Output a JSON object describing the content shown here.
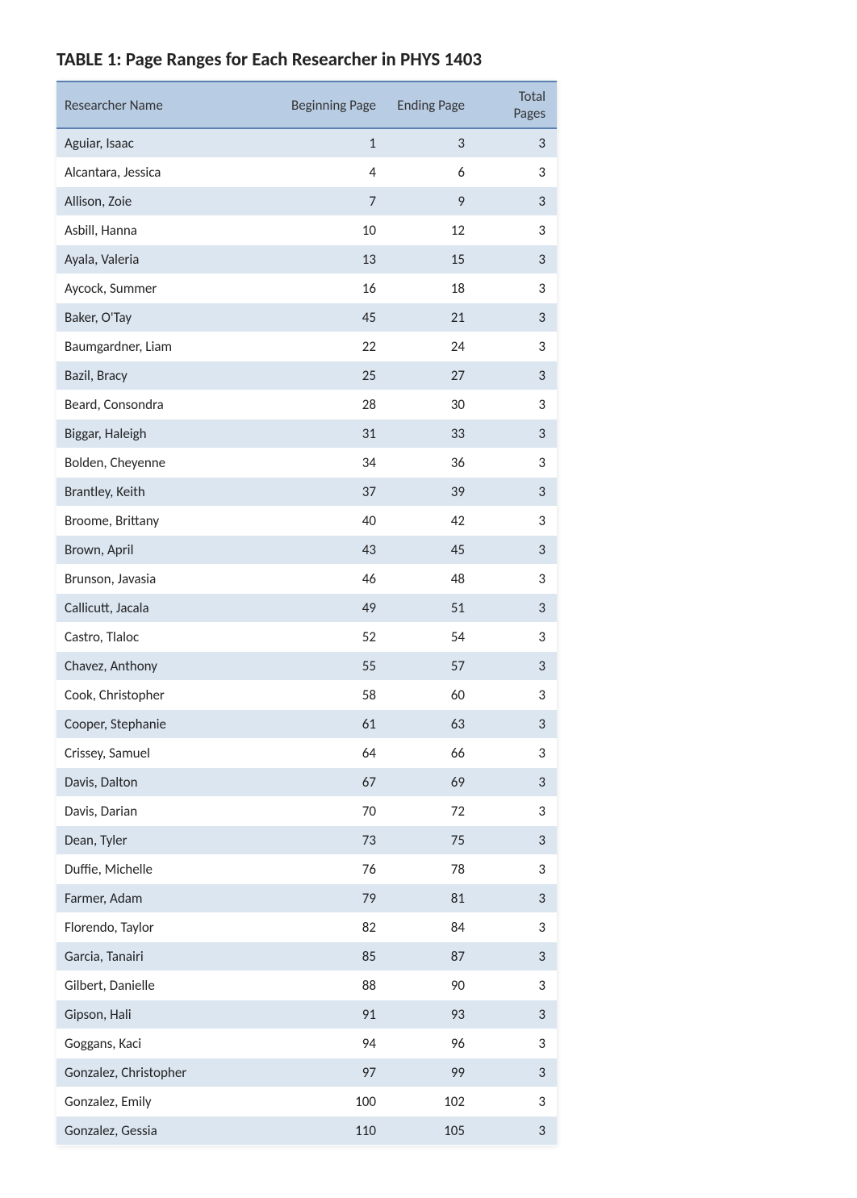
{
  "chart_data": {
    "type": "table",
    "title": "TABLE 1: Page Ranges for Each Researcher in PHYS 1403",
    "columns": [
      "Researcher Name",
      "Beginning Page",
      "Ending Page",
      "Total Pages"
    ],
    "rows": [
      {
        "name": "Aguiar, Isaac",
        "begin": "1",
        "end": "3",
        "total": "3"
      },
      {
        "name": "Alcantara, Jessica",
        "begin": "4",
        "end": "6",
        "total": "3"
      },
      {
        "name": "Allison, Zoie",
        "begin": "7",
        "end": "9",
        "total": "3"
      },
      {
        "name": "Asbill, Hanna",
        "begin": "10",
        "end": "12",
        "total": "3"
      },
      {
        "name": "Ayala, Valeria",
        "begin": "13",
        "end": "15",
        "total": "3"
      },
      {
        "name": "Aycock, Summer",
        "begin": "16",
        "end": "18",
        "total": "3"
      },
      {
        "name": "Baker, O'Tay",
        "begin": "45",
        "end": "21",
        "total": "3"
      },
      {
        "name": "Baumgardner, Liam",
        "begin": "22",
        "end": "24",
        "total": "3"
      },
      {
        "name": "Bazil, Bracy",
        "begin": "25",
        "end": "27",
        "total": "3"
      },
      {
        "name": "Beard, Consondra",
        "begin": "28",
        "end": "30",
        "total": "3"
      },
      {
        "name": "Biggar, Haleigh",
        "begin": "31",
        "end": "33",
        "total": "3"
      },
      {
        "name": "Bolden, Cheyenne",
        "begin": "34",
        "end": "36",
        "total": "3"
      },
      {
        "name": "Brantley, Keith",
        "begin": "37",
        "end": "39",
        "total": "3"
      },
      {
        "name": "Broome, Brittany",
        "begin": "40",
        "end": "42",
        "total": "3"
      },
      {
        "name": "Brown, April",
        "begin": "43",
        "end": "45",
        "total": "3"
      },
      {
        "name": "Brunson, Javasia",
        "begin": "46",
        "end": "48",
        "total": "3"
      },
      {
        "name": "Callicutt, Jacala",
        "begin": "49",
        "end": "51",
        "total": "3"
      },
      {
        "name": "Castro, Tlaloc",
        "begin": "52",
        "end": "54",
        "total": "3"
      },
      {
        "name": "Chavez, Anthony",
        "begin": "55",
        "end": "57",
        "total": "3"
      },
      {
        "name": "Cook, Christopher",
        "begin": "58",
        "end": "60",
        "total": "3"
      },
      {
        "name": "Cooper, Stephanie",
        "begin": "61",
        "end": "63",
        "total": "3"
      },
      {
        "name": "Crissey, Samuel",
        "begin": "64",
        "end": "66",
        "total": "3"
      },
      {
        "name": "Davis, Dalton",
        "begin": "67",
        "end": "69",
        "total": "3"
      },
      {
        "name": "Davis, Darian",
        "begin": "70",
        "end": "72",
        "total": "3"
      },
      {
        "name": "Dean, Tyler",
        "begin": "73",
        "end": "75",
        "total": "3"
      },
      {
        "name": "Duffie, Michelle",
        "begin": "76",
        "end": "78",
        "total": "3"
      },
      {
        "name": "Farmer, Adam",
        "begin": "79",
        "end": "81",
        "total": "3"
      },
      {
        "name": "Florendo, Taylor",
        "begin": "82",
        "end": "84",
        "total": "3"
      },
      {
        "name": "Garcia, Tanairi",
        "begin": "85",
        "end": "87",
        "total": "3"
      },
      {
        "name": "Gilbert, Danielle",
        "begin": "88",
        "end": "90",
        "total": "3"
      },
      {
        "name": "Gipson, Hali",
        "begin": "91",
        "end": "93",
        "total": "3"
      },
      {
        "name": "Goggans, Kaci",
        "begin": "94",
        "end": "96",
        "total": "3"
      },
      {
        "name": "Gonzalez, Christopher",
        "begin": "97",
        "end": "99",
        "total": "3"
      },
      {
        "name": "Gonzalez, Emily",
        "begin": "100",
        "end": "102",
        "total": "3"
      },
      {
        "name": "Gonzalez, Gessia",
        "begin": "110",
        "end": "105",
        "total": "3"
      }
    ]
  }
}
